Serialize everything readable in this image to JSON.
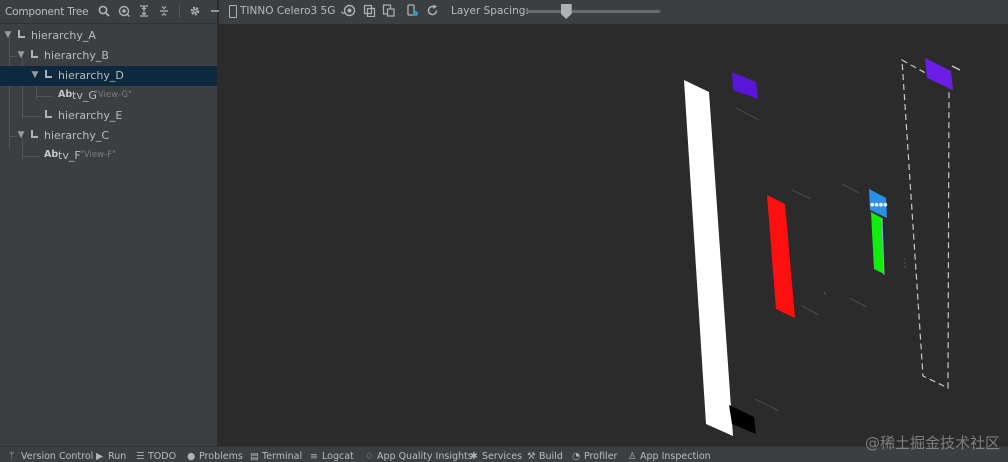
{
  "panel": {
    "title": "Component Tree",
    "icons": [
      "search-icon",
      "eye-icon",
      "expand-all-icon",
      "collapse-all-icon",
      "gear-icon",
      "minimize-icon"
    ]
  },
  "tree": [
    {
      "label": "hierarchy_A",
      "type": "group",
      "level": 0,
      "expanded": true
    },
    {
      "label": "hierarchy_B",
      "type": "group",
      "level": 1,
      "expanded": true
    },
    {
      "label": "hierarchy_D",
      "type": "group",
      "level": 2,
      "expanded": true,
      "selected": true
    },
    {
      "label": "tv_G",
      "sub": "\"View-G\"",
      "type": "text",
      "level": 3
    },
    {
      "label": "hierarchy_E",
      "type": "group",
      "level": 2
    },
    {
      "label": "hierarchy_C",
      "type": "group",
      "level": 1,
      "expanded": true
    },
    {
      "label": "tv_F",
      "sub": "\"View-F\"",
      "type": "text",
      "level": 2
    }
  ],
  "toolbar": {
    "device": "TINNO Celero3 5G",
    "device_caret": "⌄",
    "layer_spacing_label": "Layer Spacing:",
    "layer_spacing_level": 0.3
  },
  "text_icon_label": "Ab",
  "statusbar": [
    {
      "label": "Version Control",
      "icon": "branch-icon"
    },
    {
      "label": "Run",
      "icon": "run-icon"
    },
    {
      "label": "TODO",
      "icon": "todo-icon"
    },
    {
      "label": "Problems",
      "icon": "problems-icon"
    },
    {
      "label": "Terminal",
      "icon": "terminal-icon"
    },
    {
      "label": "Logcat",
      "icon": "logcat-icon"
    },
    {
      "label": "App Quality Insights",
      "icon": "insights-icon"
    },
    {
      "label": "Services",
      "icon": "services-icon"
    },
    {
      "label": "Build",
      "icon": "build-icon"
    },
    {
      "label": "Profiler",
      "icon": "profiler-icon"
    },
    {
      "label": "App Inspection",
      "icon": "inspection-icon"
    }
  ],
  "watermark": "@稀土掘金技术社区",
  "colors": {
    "accent_purple": "#6a1ee6",
    "red": "#ff1010",
    "green": "#10ee10",
    "blue": "#2a8fe8",
    "selection": "#0d293e"
  }
}
